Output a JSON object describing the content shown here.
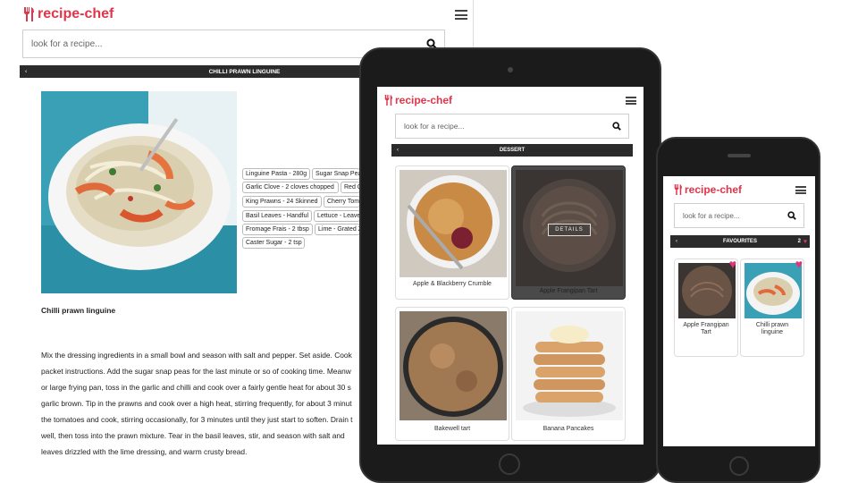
{
  "brand": {
    "name": "recipe-chef",
    "color": "#e0354b"
  },
  "search": {
    "placeholder": "look for a recipe..."
  },
  "desktop": {
    "bar_title": "CHILLI PRAWN LINGUINE",
    "recipe_title": "Chilli prawn linguine",
    "ingredients": [
      "Linguine Pasta - 280g",
      "Sugar Snap Peas",
      "Garlic Clove - 2 cloves chopped",
      "Red C",
      "King Prawns - 24 Skinned",
      "Cherry Tom",
      "Basil Leaves - Handful",
      "Lettuce - Leave",
      "Fromage Frais - 2 tbsp",
      "Lime - Grated Z",
      "Caster Sugar - 2 tsp"
    ],
    "method_lines": [
      "Mix the dressing ingredients in a small bowl and season with salt and pepper. Set aside. Cook",
      "packet instructions. Add the sugar snap peas for the last minute or so of cooking time. Meanw",
      "or large frying pan, toss in the garlic and chilli and cook over a fairly gentle heat for about 30 s",
      "garlic brown. Tip in the prawns and cook over a high heat, stirring frequently, for about 3 minut",
      "the tomatoes and cook, stirring occasionally, for 3 minutes until they just start to soften. Drain t",
      "well, then toss into the prawn mixture. Tear in the basil leaves, stir, and season with salt and",
      "leaves drizzled with the lime dressing, and warm crusty bread."
    ]
  },
  "tablet": {
    "bar_title": "DESSERT",
    "details_label": "DETAILS",
    "cards": [
      "Apple & Blackberry Crumble",
      "Apple Frangipan Tart",
      "Bakewell tart",
      "Banana Pancakes"
    ]
  },
  "phone": {
    "bar_title": "FAVOURITES",
    "fav_count": "2",
    "cards": [
      "Apple Frangipan Tart",
      "Chilli prawn linguine"
    ]
  }
}
